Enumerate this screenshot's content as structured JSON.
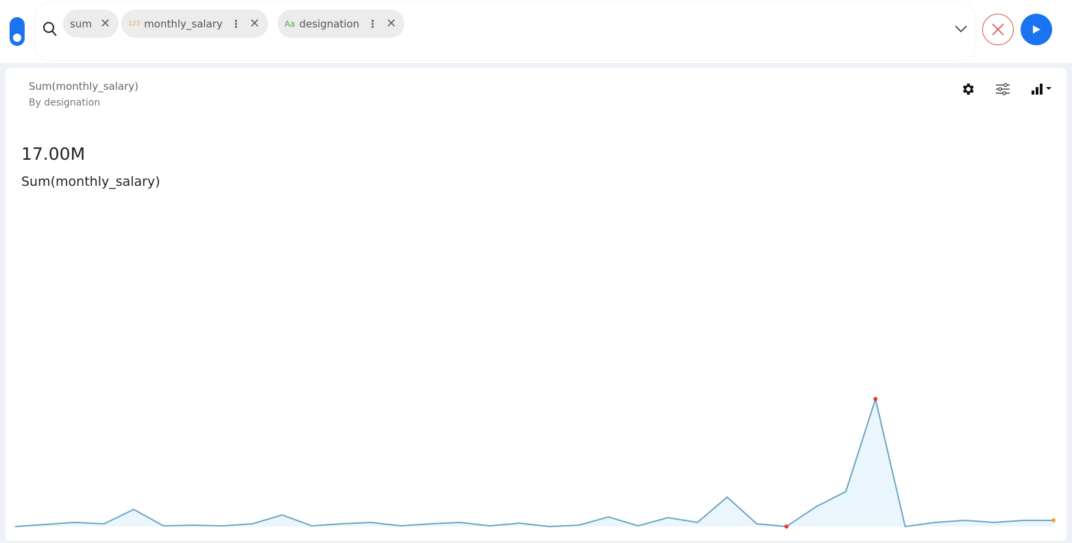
{
  "search": {
    "chips": [
      {
        "label": "sum"
      },
      {
        "tag": "123",
        "label": "monthly_salary"
      },
      {
        "tag": "Aa",
        "label": "designation"
      }
    ]
  },
  "card": {
    "title": "Sum(monthly_salary)",
    "subtitle": "By designation",
    "kpi_value": "17.00M",
    "kpi_label": "Sum(monthly_salary)"
  },
  "colors": {
    "accent": "#1a73f0",
    "line": "#6aa6c4",
    "fill": "#eaf6fb",
    "min_max": "#e53935",
    "last": "#f0a030"
  },
  "chart_data": {
    "type": "area",
    "title": "Sum(monthly_salary)",
    "xlabel": "designation",
    "ylabel": "Sum(monthly_salary)",
    "unit": "K (estimated, axis not shown)",
    "values": [
      200,
      262,
      323,
      282,
      713,
      221,
      241,
      221,
      282,
      549,
      221,
      282,
      323,
      221,
      282,
      323,
      221,
      303,
      200,
      241,
      487,
      221,
      467,
      323,
      1082,
      282,
      200,
      795,
      1246,
      4013,
      200,
      323,
      385,
      323,
      385,
      385
    ],
    "highlight": {
      "min_index": 26,
      "max_index": 29,
      "last_index": 35
    }
  }
}
